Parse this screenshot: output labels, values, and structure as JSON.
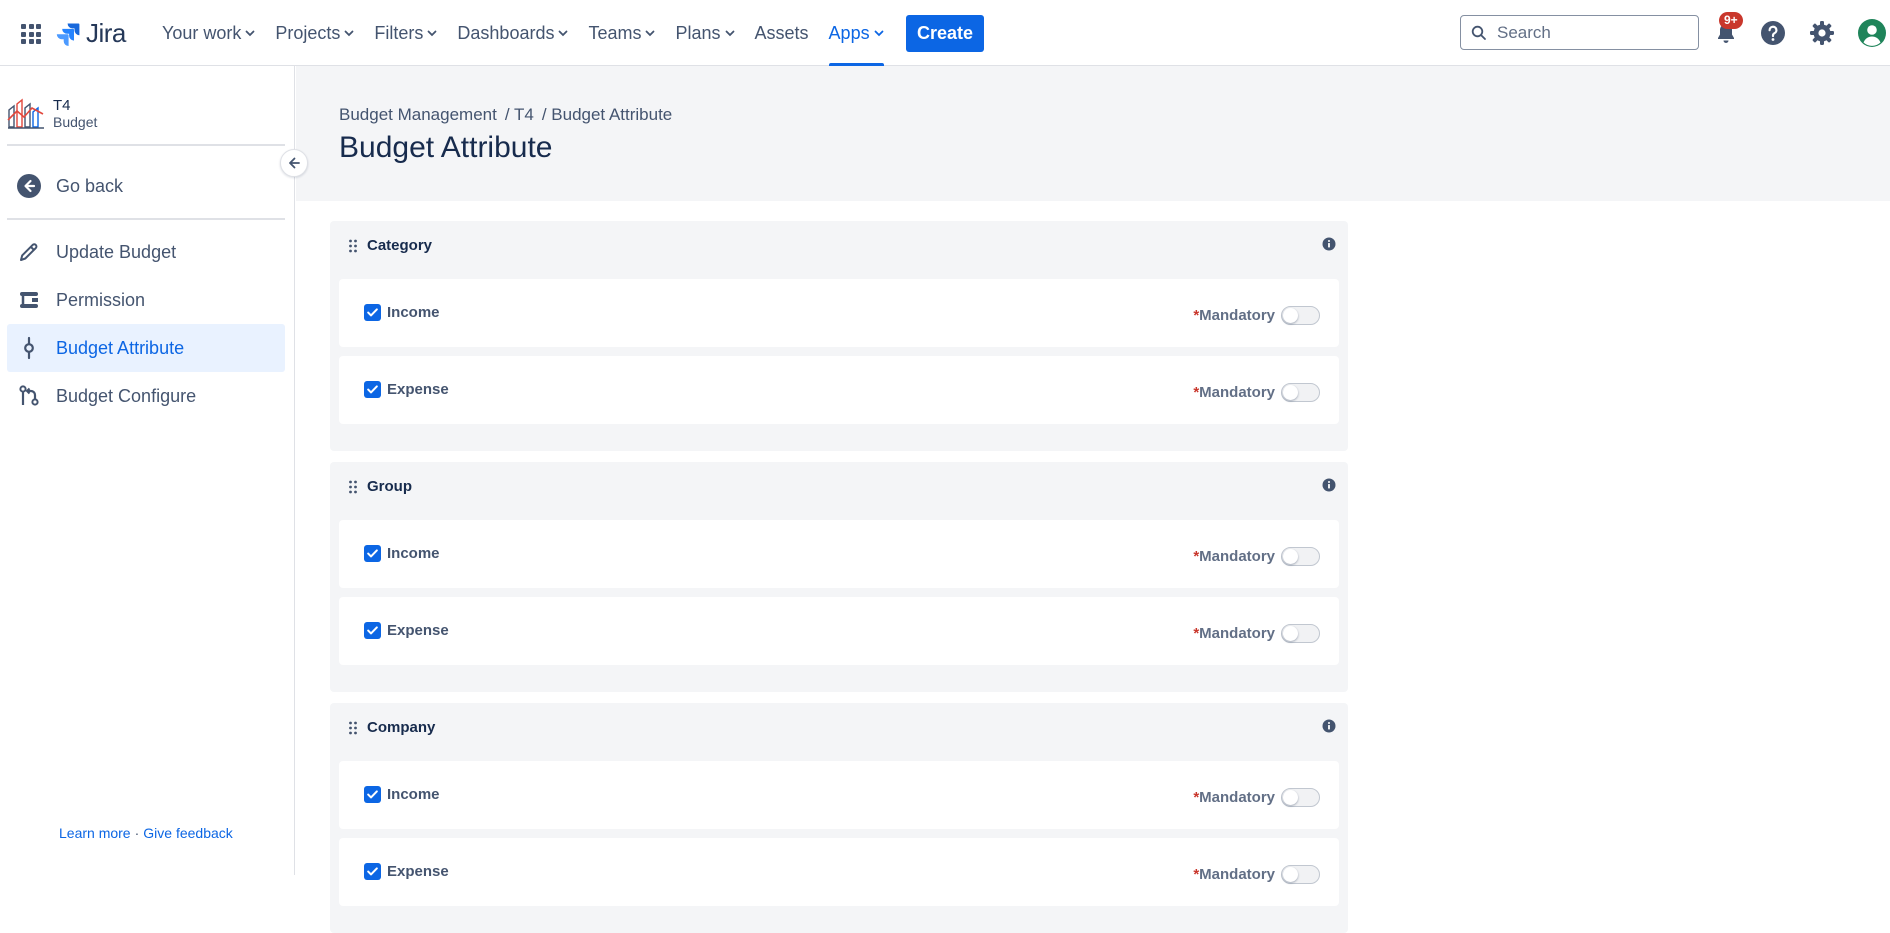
{
  "topnav": {
    "logo_text": "Jira",
    "items": [
      {
        "label": "Your work",
        "dropdown": true
      },
      {
        "label": "Projects",
        "dropdown": true
      },
      {
        "label": "Filters",
        "dropdown": true
      },
      {
        "label": "Dashboards",
        "dropdown": true
      },
      {
        "label": "Teams",
        "dropdown": true
      },
      {
        "label": "Plans",
        "dropdown": true
      },
      {
        "label": "Assets",
        "dropdown": false
      },
      {
        "label": "Apps",
        "dropdown": true,
        "active": true
      }
    ],
    "create_label": "Create",
    "search_placeholder": "Search",
    "notifications_badge": "9+"
  },
  "sidebar": {
    "project_name": "T4",
    "project_type": "Budget",
    "go_back": "Go back",
    "items": [
      {
        "label": "Update Budget",
        "icon": "pencil-icon",
        "active": false
      },
      {
        "label": "Permission",
        "icon": "permission-icon",
        "active": false
      },
      {
        "label": "Budget Attribute",
        "icon": "commit-icon",
        "active": true
      },
      {
        "label": "Budget Configure",
        "icon": "branch-icon",
        "active": false
      }
    ],
    "footer_learn": "Learn more",
    "footer_sep": "·",
    "footer_feedback": "Give feedback"
  },
  "header": {
    "breadcrumb": [
      "Budget Management",
      "/ T4",
      "/ Budget Attribute"
    ],
    "title": "Budget Attribute"
  },
  "panels": [
    {
      "title": "Category",
      "rows": [
        {
          "label": "Income",
          "mandatory_label": "Mandatory",
          "checked": true,
          "mandatory": false
        },
        {
          "label": "Expense",
          "mandatory_label": "Mandatory",
          "checked": true,
          "mandatory": false
        }
      ]
    },
    {
      "title": "Group",
      "rows": [
        {
          "label": "Income",
          "mandatory_label": "Mandatory",
          "checked": true,
          "mandatory": false
        },
        {
          "label": "Expense",
          "mandatory_label": "Mandatory",
          "checked": true,
          "mandatory": false
        }
      ]
    },
    {
      "title": "Company",
      "rows": [
        {
          "label": "Income",
          "mandatory_label": "Mandatory",
          "checked": true,
          "mandatory": false
        },
        {
          "label": "Expense",
          "mandatory_label": "Mandatory",
          "checked": true,
          "mandatory": false
        }
      ]
    }
  ],
  "colors": {
    "accent": "#0c66e4",
    "required_star": "#c9372c",
    "badge": "#c9372c",
    "panel_bg": "#f4f5f7",
    "user_avatar": "#1f845a"
  }
}
